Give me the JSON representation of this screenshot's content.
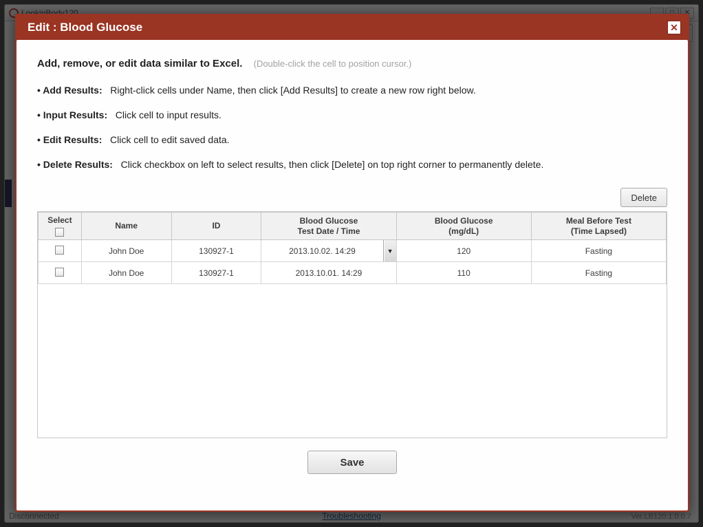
{
  "bg": {
    "appTitle": "LookinBody120",
    "status": "Disconnected",
    "troubleshoot": "Troubleshooting",
    "version": "Ver.LB120.1.0.0.7"
  },
  "modal": {
    "title": "Edit : Blood Glucose",
    "closeGlyph": "✕",
    "intro_bold": "Add, remove, or edit data similar to Excel.",
    "intro_hint": "(Double-click the cell to position cursor.)",
    "instr": [
      {
        "label": "• Add Results:",
        "text": "Right-click cells under Name, then click [Add Results] to create a new row right below."
      },
      {
        "label": "• Input Results:",
        "text": "Click cell to input results."
      },
      {
        "label": "• Edit Results:",
        "text": "Click cell to edit saved data."
      },
      {
        "label": "• Delete Results:",
        "text": "Click checkbox on left to select results, then click [Delete] on top right corner to permanently delete."
      }
    ],
    "deleteLabel": "Delete",
    "saveLabel": "Save",
    "columns": {
      "select": "Select",
      "name": "Name",
      "id": "ID",
      "dt1": "Blood Glucose",
      "dt2": "Test Date / Time",
      "bg1": "Blood Glucose",
      "bg2": "(mg/dL)",
      "meal1": "Meal Before Test",
      "meal2": "(Time Lapsed)"
    },
    "rows": [
      {
        "name": "John Doe",
        "id": "130927-1",
        "dt": "2013.10.02. 14:29",
        "bg": "120",
        "meal": "Fasting",
        "active": true
      },
      {
        "name": "John Doe",
        "id": "130927-1",
        "dt": "2013.10.01. 14:29",
        "bg": "110",
        "meal": "Fasting",
        "active": false
      }
    ]
  }
}
